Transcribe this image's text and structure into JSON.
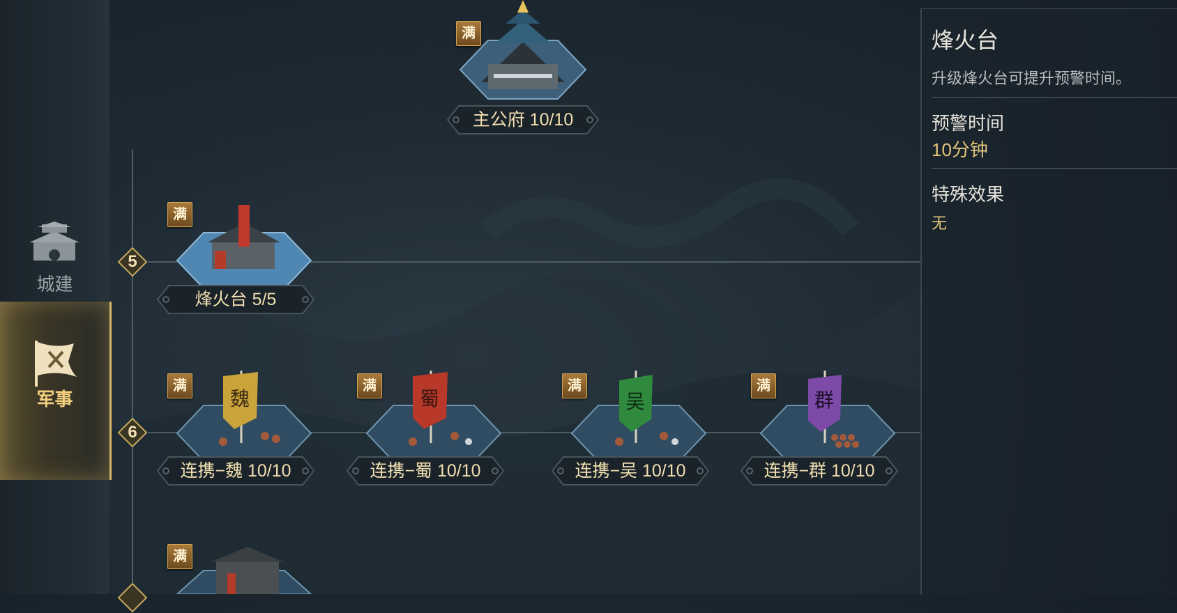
{
  "nav": {
    "items": [
      {
        "label": "城建",
        "icon": "city-gate-icon",
        "selected": false
      },
      {
        "label": "军事",
        "icon": "war-flag-icon",
        "selected": true
      }
    ]
  },
  "tree": {
    "top": {
      "label": "主公府 10/10",
      "badge": "满"
    },
    "tiers": [
      "5",
      "6"
    ],
    "row5": [
      {
        "label": "烽火台 5/5",
        "badge": "满"
      }
    ],
    "row6": [
      {
        "label": "连携−魏 10/10",
        "badge": "满",
        "banner": "魏",
        "banner_color": "#c9a43a"
      },
      {
        "label": "连携−蜀 10/10",
        "badge": "满",
        "banner": "蜀",
        "banner_color": "#b8392a"
      },
      {
        "label": "连携−吴 10/10",
        "badge": "满",
        "banner": "吴",
        "banner_color": "#2f8a3e"
      },
      {
        "label": "连携−群 10/10",
        "badge": "满",
        "banner": "群",
        "banner_color": "#7d4aa8"
      }
    ],
    "row7": [
      {
        "badge": "满"
      }
    ]
  },
  "info": {
    "title": "烽火台",
    "description": "升级烽火台可提升预警时间。",
    "stat1_label": "预警时间",
    "stat1_value": "10分钟",
    "stat2_label": "特殊效果",
    "stat2_value": "无"
  },
  "colors": {
    "accent_gold": "#e2c47a",
    "badge_brown": "#8a5f2a",
    "tile_blue": "#5b8db5"
  }
}
